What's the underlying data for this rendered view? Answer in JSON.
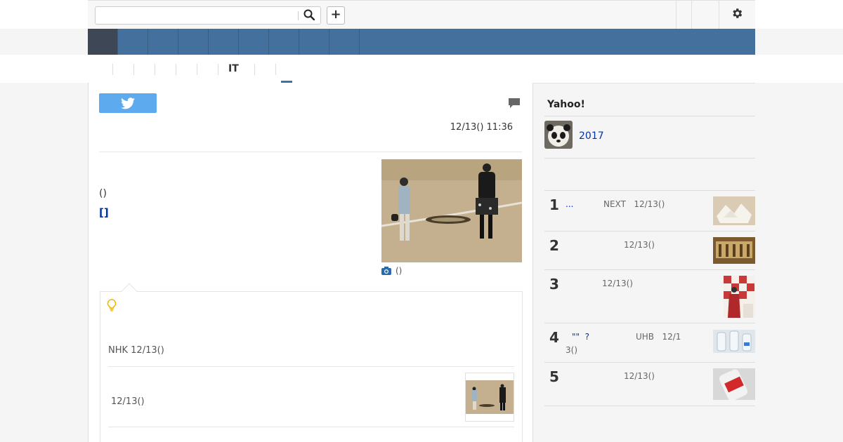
{
  "header": {
    "search_placeholder": "",
    "plus_label": "+"
  },
  "subnav": {
    "active_label": "IT"
  },
  "article": {
    "datetime": "12/13() 11:36",
    "paren_text": "()",
    "bracket_link": "[]",
    "photo_caption": "()"
  },
  "related": {
    "source_line": "NHK 12/13()",
    "item_date": "12/13()"
  },
  "sidebar": {
    "title": "Yahoo!",
    "feature_label": "2017",
    "ranking": [
      {
        "num": "1",
        "title": "...",
        "meta": "NEXT   12/13()"
      },
      {
        "num": "2",
        "title": "",
        "meta": "12/13()"
      },
      {
        "num": "3",
        "title": "",
        "meta": "12/13()"
      },
      {
        "num": "4",
        "title": "\"\"  ?",
        "meta": "UHB   12/1",
        "meta2": "3()"
      },
      {
        "num": "5",
        "title": "",
        "meta": "12/13()"
      }
    ]
  },
  "colors": {
    "nav": "#43709d",
    "nav_active": "#3d4755",
    "twitter": "#5eaaee",
    "link": "#0033aa"
  }
}
